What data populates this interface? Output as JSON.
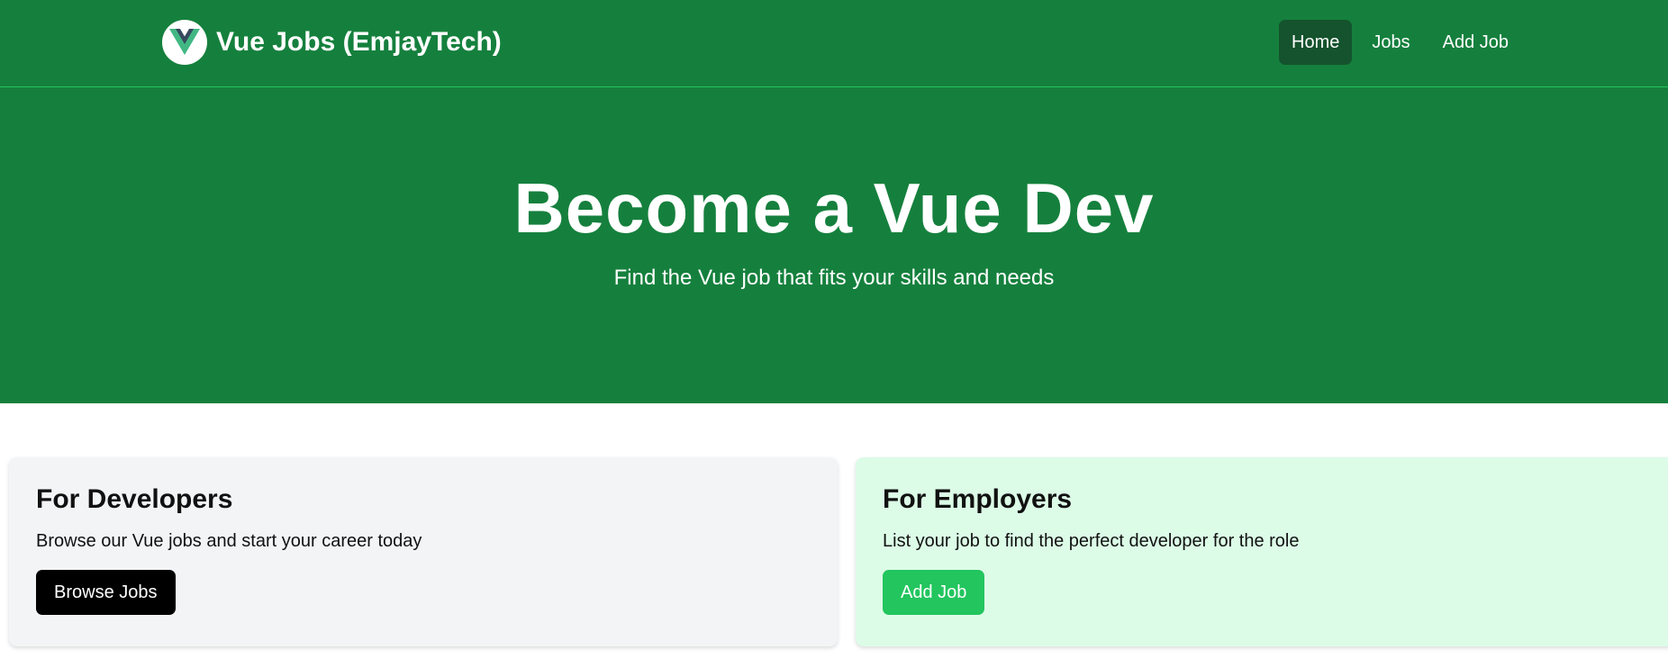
{
  "brand": {
    "title": "Vue Jobs (EmjayTech)",
    "logo_icon": "vue-logo-icon"
  },
  "nav": {
    "items": [
      {
        "label": "Home",
        "active": true
      },
      {
        "label": "Jobs",
        "active": false
      },
      {
        "label": "Add Job",
        "active": false
      }
    ]
  },
  "hero": {
    "title": "Become a Vue Dev",
    "subtitle": "Find the Vue job that fits your skills and needs"
  },
  "cards": {
    "developers": {
      "title": "For Developers",
      "text": "Browse our Vue jobs and start your career today",
      "button": "Browse Jobs"
    },
    "employers": {
      "title": "For Employers",
      "text": "List your job to find the perfect developer for the role",
      "button": "Add Job"
    }
  },
  "colors": {
    "primary_green": "#15803d",
    "active_nav": "#14532d",
    "accent_green": "#22c55e",
    "developer_card_bg": "#f3f4f6",
    "employer_card_bg": "#dcfce7"
  }
}
